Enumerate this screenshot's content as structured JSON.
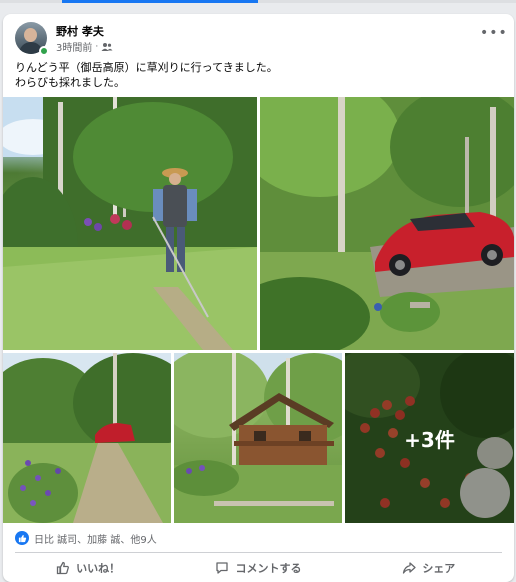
{
  "post": {
    "author": "野村 孝夫",
    "time": "3時間前",
    "separator": "·",
    "audience_icon": "friends-icon",
    "text_line1": "りんどう平（御岳高原）に草刈りに行ってきました。",
    "text_line2": "わらびも採れました。"
  },
  "photos": {
    "more_count": "+3件"
  },
  "reactions": {
    "summary": "日比 誠司、加藤 誠、他9人"
  },
  "actions": {
    "like": "いいね！",
    "comment": "コメントする",
    "share": "シェア"
  },
  "colors": {
    "brand": "#1877f2",
    "online": "#31a24c",
    "secondary_text": "#65676b"
  }
}
